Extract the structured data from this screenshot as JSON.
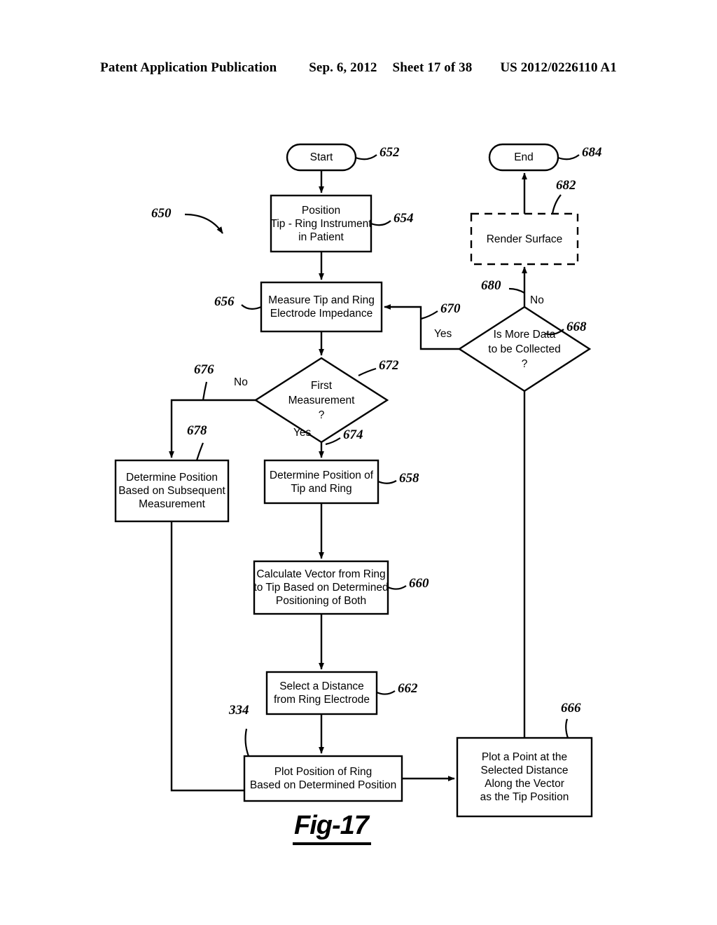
{
  "header": {
    "publication": "Patent Application Publication",
    "date": "Sep. 6, 2012",
    "sheet": "Sheet 17 of 38",
    "patent_number": "US 2012/0226110 A1"
  },
  "figure": {
    "caption": "Fig-17",
    "diagram_ref": "650"
  },
  "nodes": {
    "start": {
      "label": "Start",
      "ref": "652",
      "shape": "terminator"
    },
    "position_instrument": {
      "lines": [
        "Position",
        "Tip - Ring Instrument",
        "in Patient"
      ],
      "ref": "654",
      "shape": "process"
    },
    "measure_impedance": {
      "lines": [
        "Measure Tip and Ring",
        "Electrode Impedance"
      ],
      "ref": "656",
      "shape": "process"
    },
    "first_measurement": {
      "lines": [
        "First",
        "Measurement",
        "?"
      ],
      "ref": "672",
      "shape": "decision"
    },
    "determine_subsequent": {
      "lines": [
        "Determine Position",
        "Based on Subsequent",
        "Measurement"
      ],
      "ref": "678",
      "shape": "process"
    },
    "determine_tip_ring": {
      "lines": [
        "Determine Position of",
        "Tip and Ring"
      ],
      "ref": "658",
      "shape": "process"
    },
    "calculate_vector": {
      "lines": [
        "Calculate Vector from Ring",
        "to Tip Based on Determined",
        "Positioning of Both"
      ],
      "ref": "660",
      "shape": "process"
    },
    "select_distance": {
      "lines": [
        "Select a Distance",
        "from Ring Electrode"
      ],
      "ref": "662",
      "shape": "process"
    },
    "plot_ring_position": {
      "lines": [
        "Plot Position of Ring",
        "Based on Determined Position"
      ],
      "ref": "334",
      "shape": "process"
    },
    "plot_tip_point": {
      "lines": [
        "Plot a Point at the",
        "Selected Distance",
        "Along the Vector",
        "as the Tip Position"
      ],
      "ref": "666",
      "shape": "process"
    },
    "more_data": {
      "lines": [
        "Is More Data",
        "to be Collected",
        "?"
      ],
      "ref": "668",
      "shape": "decision"
    },
    "render_surface": {
      "lines": [
        "Render Surface"
      ],
      "ref": "682",
      "shape": "process-dashed"
    },
    "end": {
      "label": "End",
      "ref": "684",
      "shape": "terminator"
    }
  },
  "edges": {
    "first_measurement_no": {
      "label": "No",
      "ref": "676"
    },
    "first_measurement_yes": {
      "label": "Yes",
      "ref": "674"
    },
    "more_data_yes": {
      "label": "Yes",
      "ref": "670"
    },
    "more_data_no": {
      "label": "No",
      "ref": "680"
    }
  },
  "colors": {
    "line": "#000000",
    "background": "#ffffff",
    "text": "#000000"
  }
}
